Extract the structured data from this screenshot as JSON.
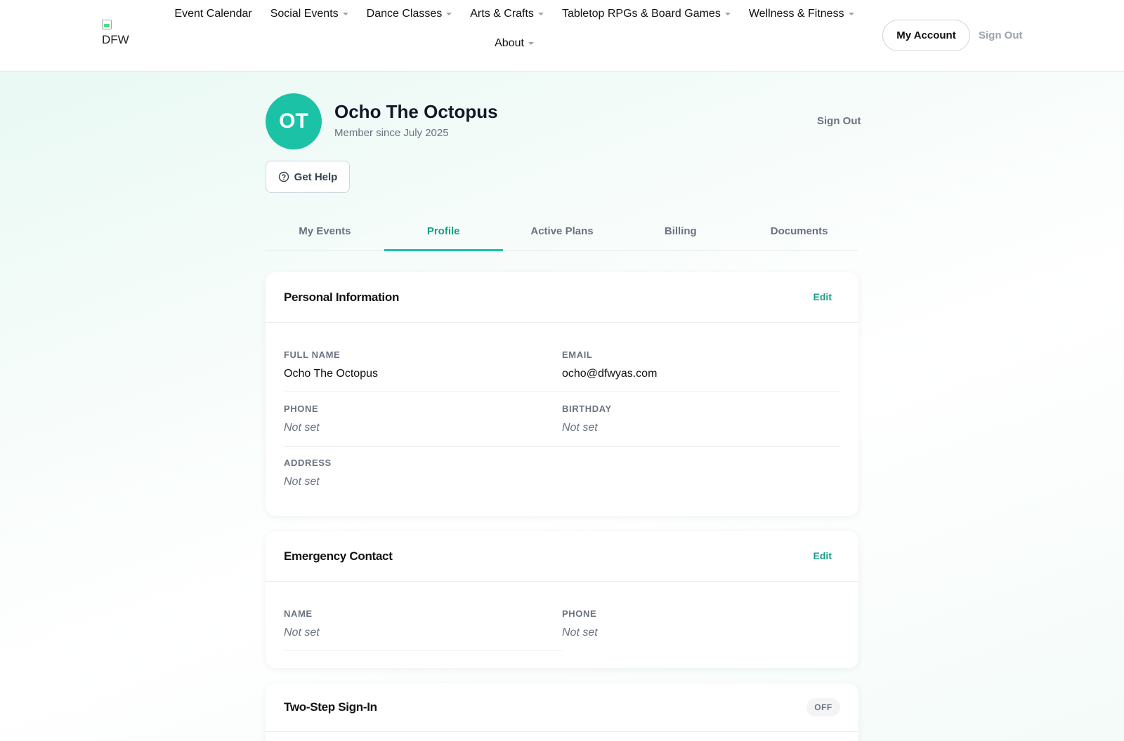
{
  "header": {
    "logo_text": "DFW",
    "nav": [
      {
        "label": "Event Calendar",
        "dropdown": false
      },
      {
        "label": "Social Events",
        "dropdown": true
      },
      {
        "label": "Dance Classes",
        "dropdown": true
      },
      {
        "label": "Arts & Crafts",
        "dropdown": true
      },
      {
        "label": "Tabletop RPGs & Board Games",
        "dropdown": true
      },
      {
        "label": "Wellness & Fitness",
        "dropdown": true
      },
      {
        "label": "About",
        "dropdown": true
      }
    ],
    "account_label": "My Account",
    "signout_label": "Sign Out"
  },
  "profile": {
    "initials": "OT",
    "name": "Ocho The Octopus",
    "member_since": "Member since July 2025",
    "signout_label": "Sign Out",
    "help_label": "Get Help",
    "avatar_color": "#1bc2a6"
  },
  "tabs": [
    {
      "label": "My Events",
      "active": false
    },
    {
      "label": "Profile",
      "active": true
    },
    {
      "label": "Active Plans",
      "active": false
    },
    {
      "label": "Billing",
      "active": false
    },
    {
      "label": "Documents",
      "active": false
    }
  ],
  "personal_info": {
    "title": "Personal Information",
    "edit_label": "Edit",
    "full_name_label": "FULL NAME",
    "full_name": "Ocho The Octopus",
    "email_label": "EMAIL",
    "email": "ocho@dfwyas.com",
    "phone_label": "PHONE",
    "phone": "Not set",
    "birthday_label": "BIRTHDAY",
    "birthday": "Not set",
    "address_label": "ADDRESS",
    "address": "Not set"
  },
  "emergency_contact": {
    "title": "Emergency Contact",
    "edit_label": "Edit",
    "name_label": "NAME",
    "name": "Not set",
    "phone_label": "PHONE",
    "phone": "Not set"
  },
  "two_step": {
    "title": "Two-Step Sign-In",
    "status": "OFF"
  },
  "colors": {
    "accent": "#1bc2a6",
    "accent_text": "#159e88",
    "muted_text": "#6b7280"
  }
}
